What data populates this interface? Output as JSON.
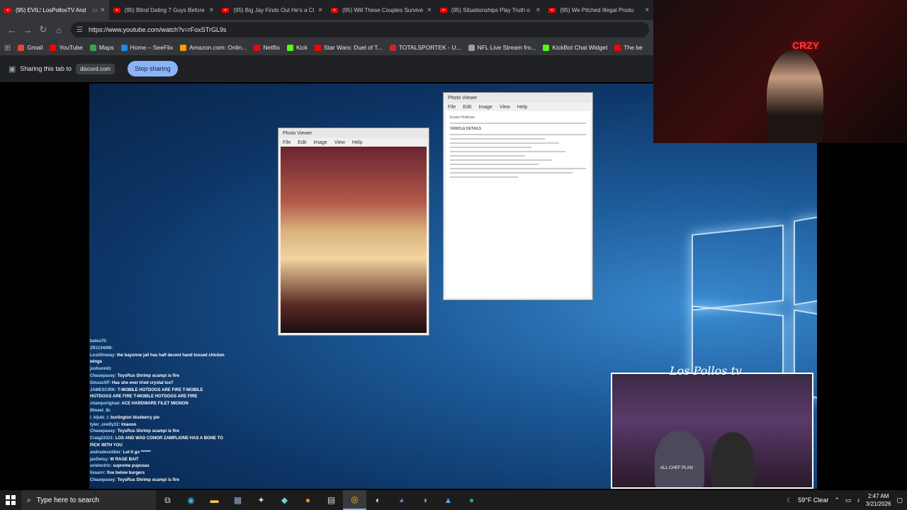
{
  "tabs": [
    {
      "title": "(95) EVIL! LosPollosTV And",
      "active": true,
      "mini": "▭"
    },
    {
      "title": "(95) Blind Dating 7 Guys Before",
      "active": false
    },
    {
      "title": "(95) Big Jay Finds Out He's a Cl",
      "active": false
    },
    {
      "title": "(95) Will These Couples Survive",
      "active": false
    },
    {
      "title": "(95) Situationships Play Truth o",
      "active": false
    },
    {
      "title": "(95) We Pitched Illegal Produ",
      "active": false
    }
  ],
  "toolbar": {
    "url": "https://www.youtube.com/watch?v=rFoxSTrGL9s"
  },
  "bookmarks": [
    {
      "label": "Gmail",
      "color": "#ea4335"
    },
    {
      "label": "YouTube",
      "color": "#ff0000"
    },
    {
      "label": "Maps",
      "color": "#34a853"
    },
    {
      "label": "Home – SeeFlix",
      "color": "#1e88e5"
    },
    {
      "label": "Amazon.com: Onlin...",
      "color": "#ff9900"
    },
    {
      "label": "Netflix",
      "color": "#e50914"
    },
    {
      "label": "Kick",
      "color": "#53fc18"
    },
    {
      "label": "Star Wars: Duel of T...",
      "color": "#ff0000"
    },
    {
      "label": "TOTALSPORTEK - U...",
      "color": "#c62828"
    },
    {
      "label": "NFL Live Stream fro...",
      "color": "#9e9e9e"
    },
    {
      "label": "KickBot Chat Widget",
      "color": "#53fc18"
    },
    {
      "label": "The be",
      "color": "#ff0000"
    }
  ],
  "sharebar": {
    "text": "Sharing this tab to",
    "target": "discord.com",
    "stop": "Stop sharing"
  },
  "photo_viewer_1": {
    "title": "Photo Viewer",
    "menu": [
      "File",
      "Edit",
      "Image",
      "View",
      "Help"
    ]
  },
  "photo_viewer_2": {
    "title": "Photo Viewer",
    "menu": [
      "File",
      "Edit",
      "Image",
      "View",
      "Help"
    ],
    "doc_header": "Evans Holshaw",
    "doc_sub": "VEHICLE DETAILS"
  },
  "chat": [
    {
      "user": "bates70:",
      "msg": ""
    },
    {
      "user": "ZR1CH099:",
      "msg": ""
    },
    {
      "user": "Lostillinway:",
      "msg": "the bayonne jail has half decent hand tossed chicken wings"
    },
    {
      "user": "jushunnitz",
      "msg": ""
    },
    {
      "user": "Chasepasey:",
      "msg": "ToysRus Shrimp scampi is fire"
    },
    {
      "user": "SmuzeXP:",
      "msg": "Has she ever tried crystal los?"
    },
    {
      "user": "JAMESCIRK:",
      "msg": "T-MOBILE HOTDOGS ARE FIRE T-MOBILE HOTDOGS ARE FIRE T-MOBILE HOTDOGS ARE FIRE"
    },
    {
      "user": "champoriginal:",
      "msg": "ACE HARDWARE FILET MIGNON"
    },
    {
      "user": "Illmeet_Ib:",
      "msg": ""
    },
    {
      "user": "i_kijuki_i:",
      "msg": "burlington blueberry pie"
    },
    {
      "user": "tyler_oreilly12:",
      "msg": "lmaooo"
    },
    {
      "user": "Chasepasey:",
      "msg": "ToysRus Shrimp scampi is fire"
    },
    {
      "user": "Craig23321:",
      "msg": "LOS AND WAD CONOR ZAMPLIONE HAS A BONE TO PICK WITH YOU"
    },
    {
      "user": "andradesoldier:",
      "msg": "Let it go ******"
    },
    {
      "user": "jaxDetsy:",
      "msg": "W RAGE BAIT"
    },
    {
      "user": "urielectric:",
      "msg": "supreme pupusas"
    },
    {
      "user": "lissarrr:",
      "msg": "five below burgers"
    },
    {
      "user": "Chasepasey:",
      "msg": "ToysRus Shrimp scampi is fire"
    }
  ],
  "webcam": {
    "neon_sign": "CRZY"
  },
  "overlay": {
    "logo": "Los Pollos tv",
    "shirt": "ALL CHEF PLAN"
  },
  "taskbar": {
    "search_placeholder": "Type here to search",
    "weather": "59°F Clear",
    "time": "2:47 AM",
    "date": "3/21/2026"
  }
}
